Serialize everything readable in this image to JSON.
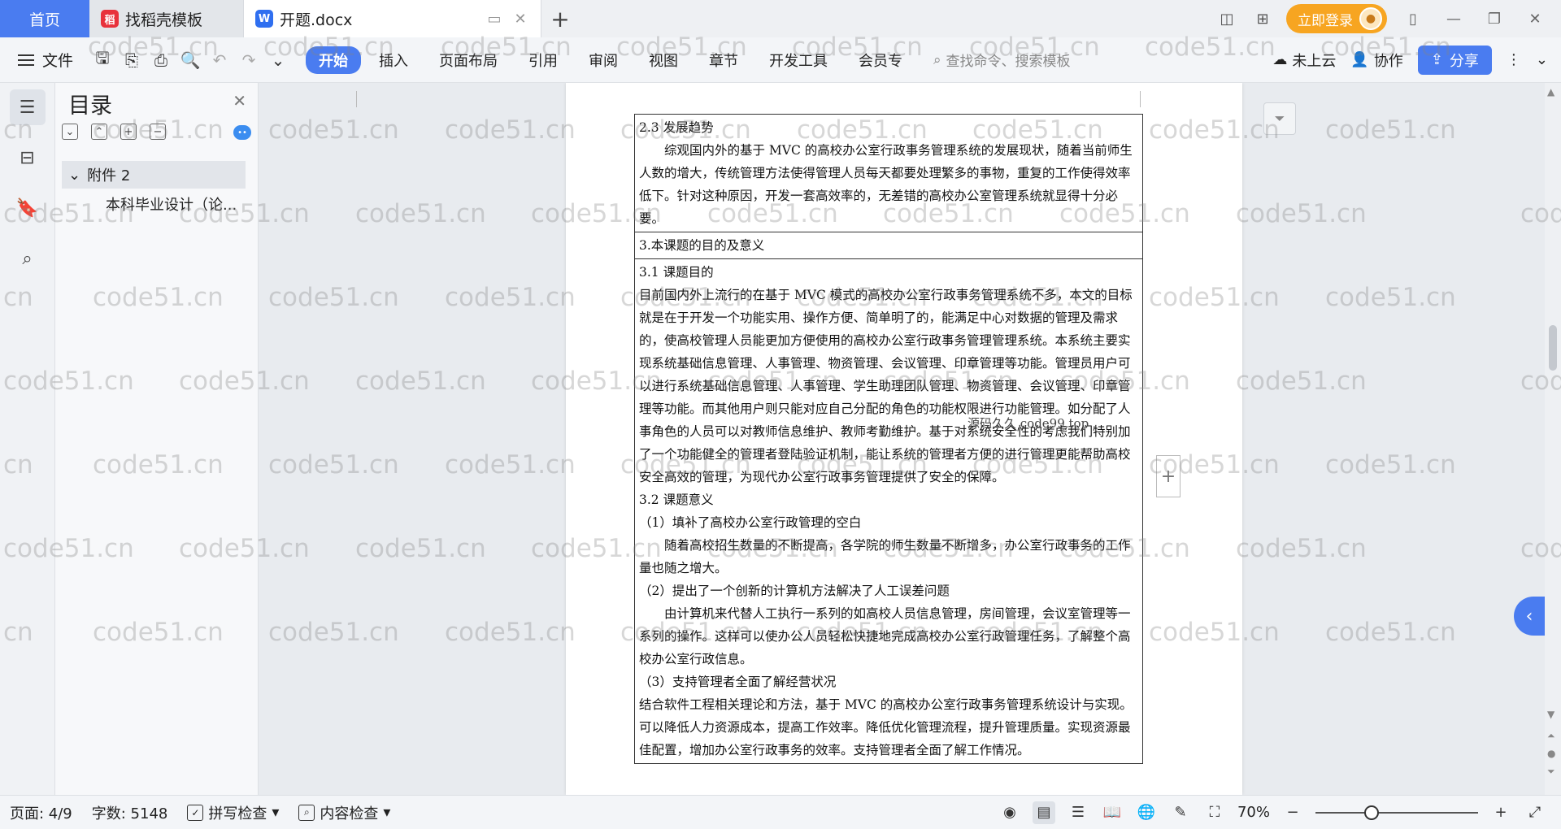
{
  "tabs": {
    "home": "首页",
    "templates": "找稻壳模板",
    "document": "开题.docx"
  },
  "topbar": {
    "login_label": "立即登录"
  },
  "ribbon": {
    "file_label": "文件",
    "tabs": [
      "开始",
      "插入",
      "页面布局",
      "引用",
      "审阅",
      "视图",
      "章节",
      "开发工具",
      "会员专"
    ],
    "search_placeholder": "查找命令、搜索模板",
    "cloud_label": "未上云",
    "collab_label": "协作",
    "share_label": "分享"
  },
  "toc": {
    "title": "目录",
    "item_level1": "附件 2",
    "item_level2": "本科毕业设计（论..."
  },
  "document": {
    "cell1": {
      "heading": "2.3 发展趋势",
      "para": "综观国内外的基于 MVC 的高校办公室行政事务管理系统的发展现状，随着当前师生人数的增大，传统管理方法使得管理人员每天都要处理繁多的事物，重复的工作使得效率低下。针对这种原因，开发一套高效率的，无差错的高校办公室管理系统就显得十分必要。"
    },
    "cell2": {
      "heading": "3.本课题的目的及意义"
    },
    "cell3": {
      "sub1": "3.1 课题目的",
      "para1": "目前国内外上流行的在基于 MVC 模式的高校办公室行政事务管理系统不多，本文的目标就是在于开发一个功能实用、操作方便、简单明了的，能满足中心对数据的管理及需求的，使高校管理人员能更加方便使用的高校办公室行政事务管理管理系统。本系统主要实现系统基础信息管理、人事管理、物资管理、会议管理、印章管理等功能。管理员用户可以进行系统基础信息管理、人事管理、学生助理团队管理、物资管理、会议管理、印章管理等功能。而其他用户则只能对应自己分配的角色的功能权限进行功能管理。如分配了人事角色的人员可以对教师信息维护、教师考勤维护。基于对系统安全性的考虑我们特别加了一个功能健全的管理者登陆验证机制，能让系统的管理者方便的进行管理更能帮助高校安全高效的管理，为现代办公室行政事务管理提供了安全的保障。",
      "sub2": "3.2 课题意义",
      "item1": "（1）填补了高校办公室行政管理的空白",
      "item1_para": "随着高校招生数量的不断提高，各学院的师生数量不断增多，办公室行政事务的工作量也随之增大。",
      "item2": "（2）提出了一个创新的计算机方法解决了人工误差问题",
      "item2_para": "由计算机来代替人工执行一系列的如高校人员信息管理，房间管理，会议室管理等一系列的操作。这样可以使办公人员轻松快捷地完成高校办公室行政管理任务，了解整个高校办公室行政信息。",
      "item3": "（3）支持管理者全面了解经营状况",
      "item3_para": "结合软件工程相关理论和方法，基于 MVC 的高校办公室行政事务管理系统设计与实现。可以降低人力资源成本，提高工作效率。降低优化管理流程，提升管理质量。实现资源最佳配置，增加办公室行政事务的效率。支持管理者全面了解工作情况。"
    },
    "inline_watermark": "源码久久 code99.top"
  },
  "watermark": {
    "text": "code51.cn",
    "partial": "cn",
    "partial_left": "cod"
  },
  "status": {
    "page": "页面: 4/9",
    "words": "字数: 5148",
    "spell": "拼写检查",
    "content_check": "内容检查",
    "zoom": "70%"
  },
  "colors": {
    "accent": "#4a7cf0",
    "login": "#f7a521"
  },
  "icons": [
    "menu-icon",
    "save-icon",
    "export-icon",
    "print-icon",
    "preview-icon",
    "undo-icon",
    "redo-icon",
    "search-icon",
    "cloud-icon",
    "collab-icon",
    "share-icon",
    "more-icon",
    "toc-icon",
    "nav-icon",
    "bookmark-icon",
    "find-icon",
    "eye-icon",
    "zoom-in-icon",
    "zoom-out-icon",
    "fullscreen-icon"
  ]
}
